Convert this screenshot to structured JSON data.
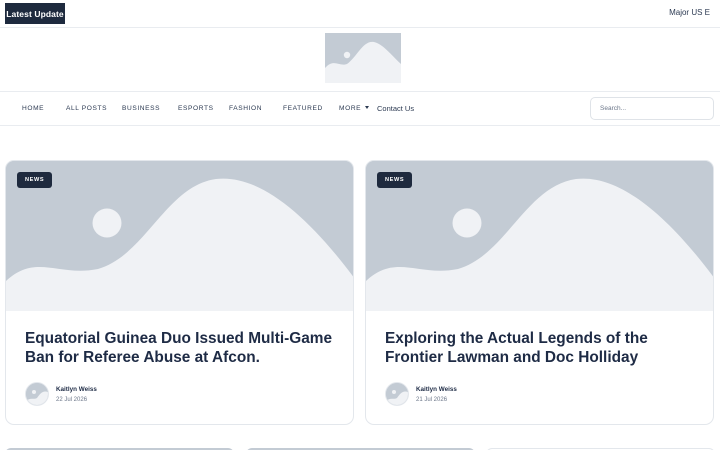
{
  "topbar": {
    "latest_label": "Latest  Update",
    "ticker_text": "Major US E"
  },
  "logo": {
    "icon": "image-placeholder-icon"
  },
  "nav": {
    "items": [
      "Home",
      "All Posts",
      "Business",
      "Esports",
      "Fashion",
      "Featured",
      "More"
    ],
    "contact_label": "Contact Us",
    "search_placeholder": "Search..."
  },
  "cards": [
    {
      "badge": "NEWS",
      "title": "Equatorial Guinea Duo Issued Multi-Game Ban for Referee Abuse at Afcon.",
      "author": "Kaitlyn Weiss",
      "date": "22 Jul 2026"
    },
    {
      "badge": "NEWS",
      "title": "Exploring the Actual Legends of the Frontier Lawman and Doc Holliday",
      "author": "Kaitlyn Weiss",
      "date": "21 Jul 2026"
    }
  ],
  "colors": {
    "dark": "#1e2a3e",
    "placeholder": "#c3cbd4",
    "placeholder_light": "#f0f2f5",
    "text": "#1e2b45"
  }
}
